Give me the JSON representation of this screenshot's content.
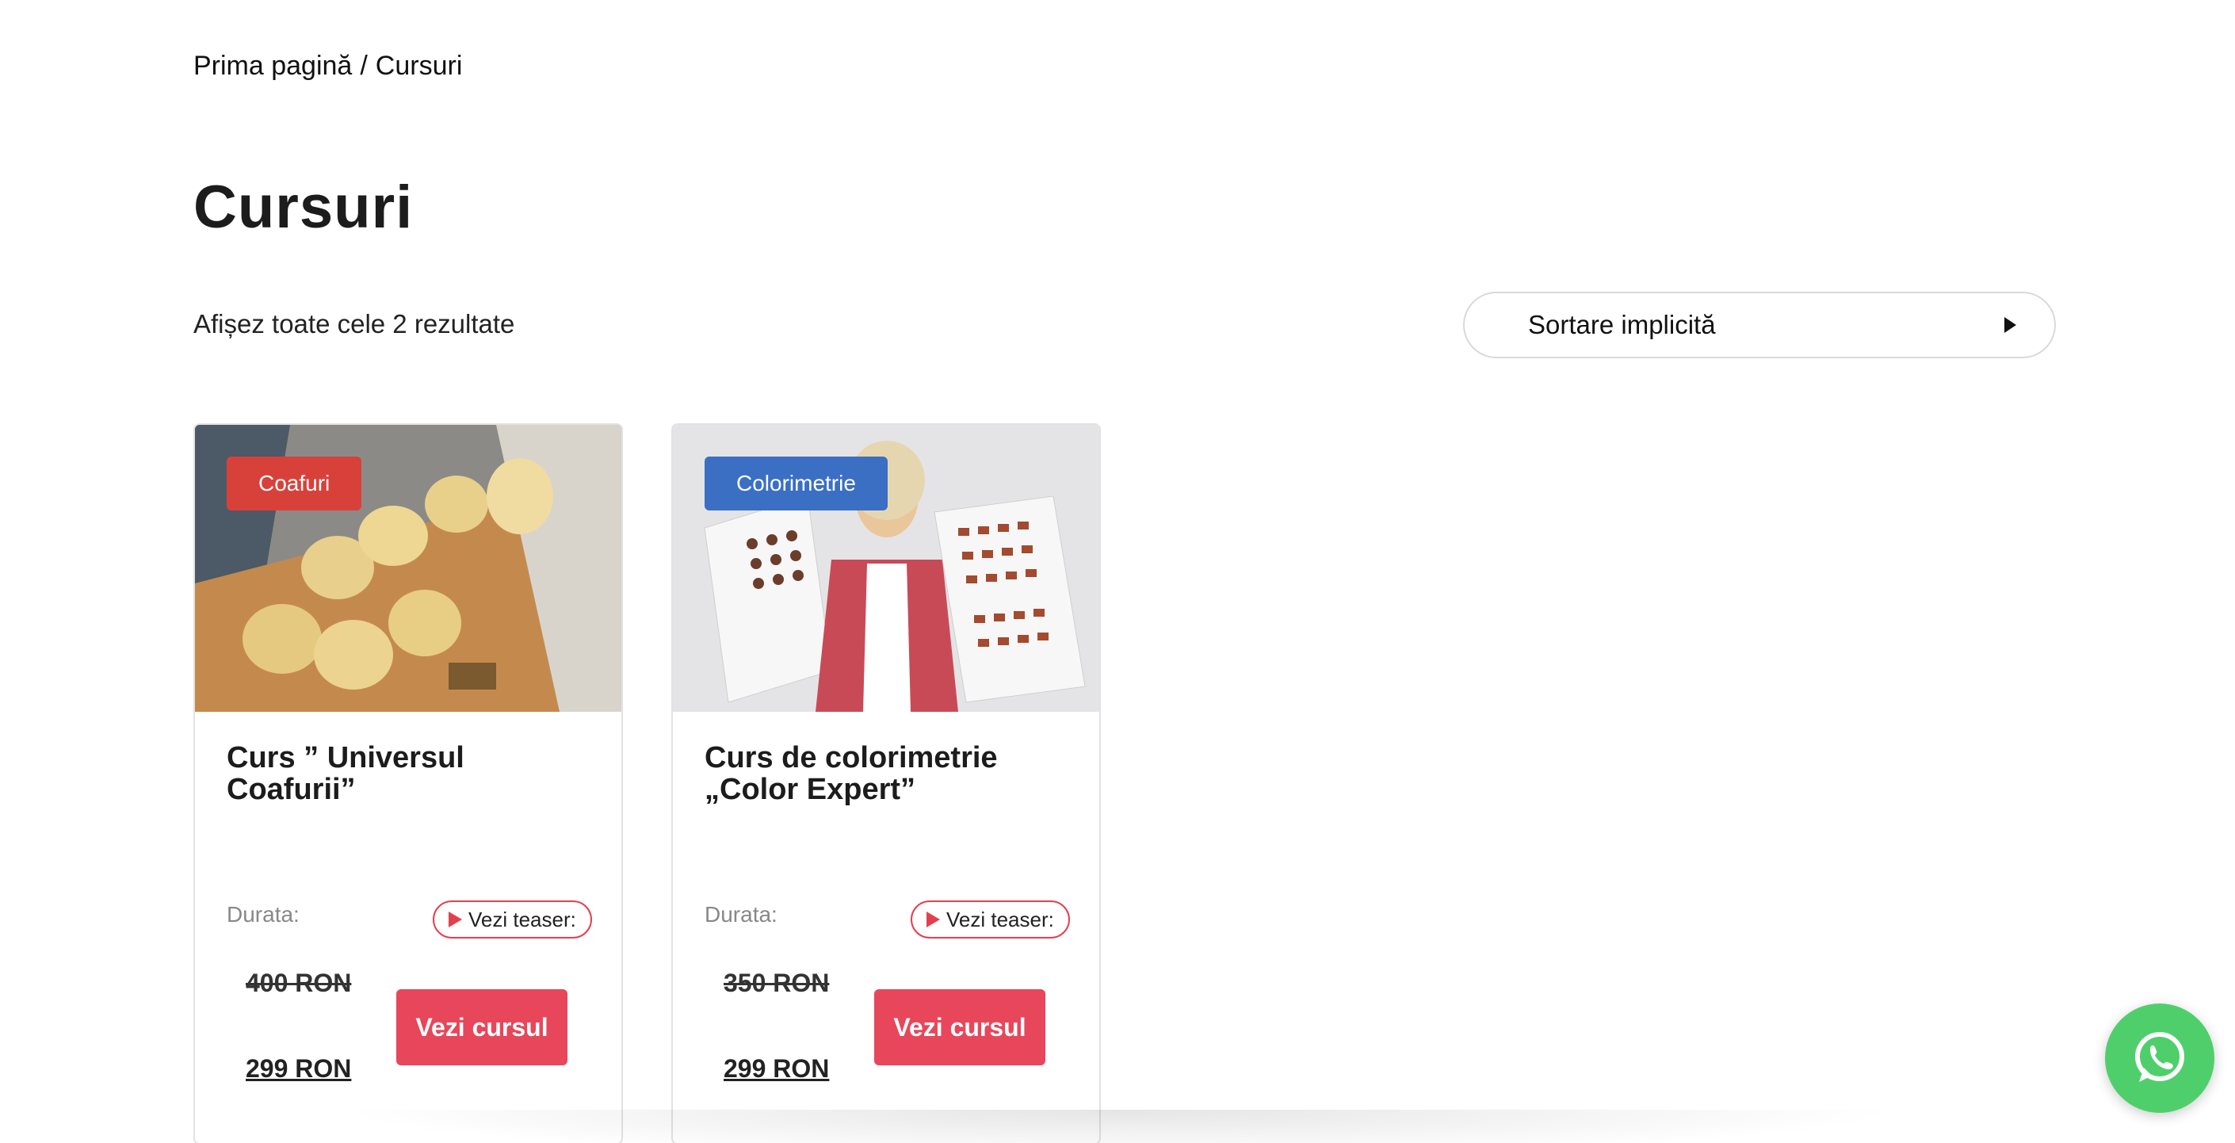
{
  "breadcrumb": {
    "home": "Prima pagină",
    "separator": "/",
    "current": "Cursuri"
  },
  "page": {
    "title": "Cursuri",
    "result_count": "Afișez toate cele 2 rezultate"
  },
  "sort": {
    "selected": "Sortare implicită",
    "icon": "caret-right-icon"
  },
  "products": [
    {
      "category": "Coafuri",
      "category_color": "#d8413a",
      "title": "Curs ” Universul Coafurii”",
      "duration_label": "Durata:",
      "teaser_label": "Vezi teaser:",
      "old_price": "400 RON",
      "new_price": "299 RON",
      "cta": "Vezi cursul",
      "image_icon": "hairstyle-mannequins-image"
    },
    {
      "category": "Colorimetrie",
      "category_color": "#3a6fc4",
      "title": "Curs de colorimetrie „Color Expert”",
      "duration_label": "Durata:",
      "teaser_label": "Vezi teaser:",
      "old_price": "350 RON",
      "new_price": "299 RON",
      "cta": "Vezi cursul",
      "image_icon": "color-chart-presenter-image"
    }
  ],
  "colors": {
    "accent": "#e8465a",
    "teaser_border": "#e3404f",
    "whatsapp": "#4fcf6b"
  },
  "whatsapp": {
    "icon": "whatsapp-icon"
  }
}
